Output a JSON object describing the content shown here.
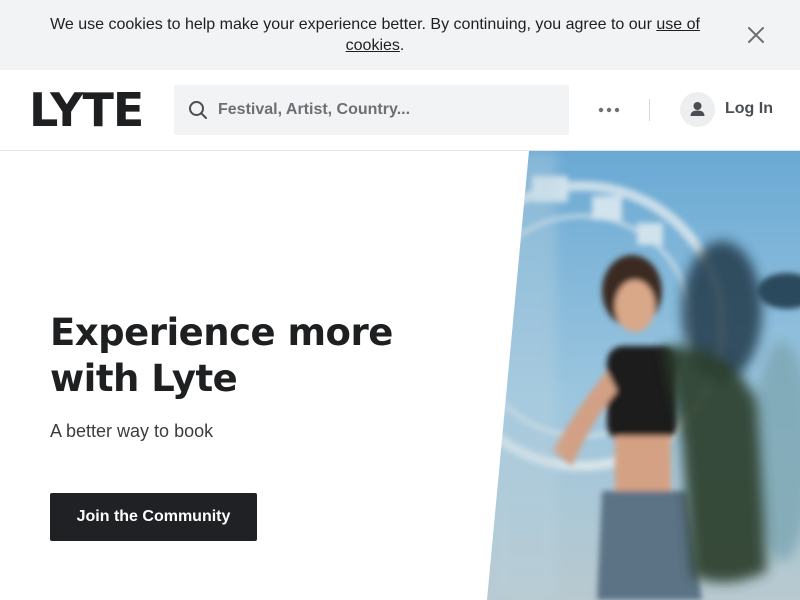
{
  "cookie_banner": {
    "text_before": "We use cookies to help make your experience better. By continuing, you agree to our ",
    "link_text": "use of cookies",
    "text_after": ".",
    "close_icon": "close-icon"
  },
  "header": {
    "logo": "LYTE",
    "search": {
      "placeholder": "Festival, Artist, Country...",
      "value": "",
      "icon": "search-icon"
    },
    "more_icon": "more-horizontal-icon",
    "login": {
      "label": "Log In",
      "icon": "user-icon"
    }
  },
  "hero": {
    "title": "Experience more with Lyte",
    "subtitle": "A better way to book",
    "cta_label": "Join the Community"
  },
  "colors": {
    "banner_bg": "#f2f3f4",
    "text": "#1d1f21",
    "cta_bg": "#1f2124",
    "sky": "#7fb4d6"
  }
}
